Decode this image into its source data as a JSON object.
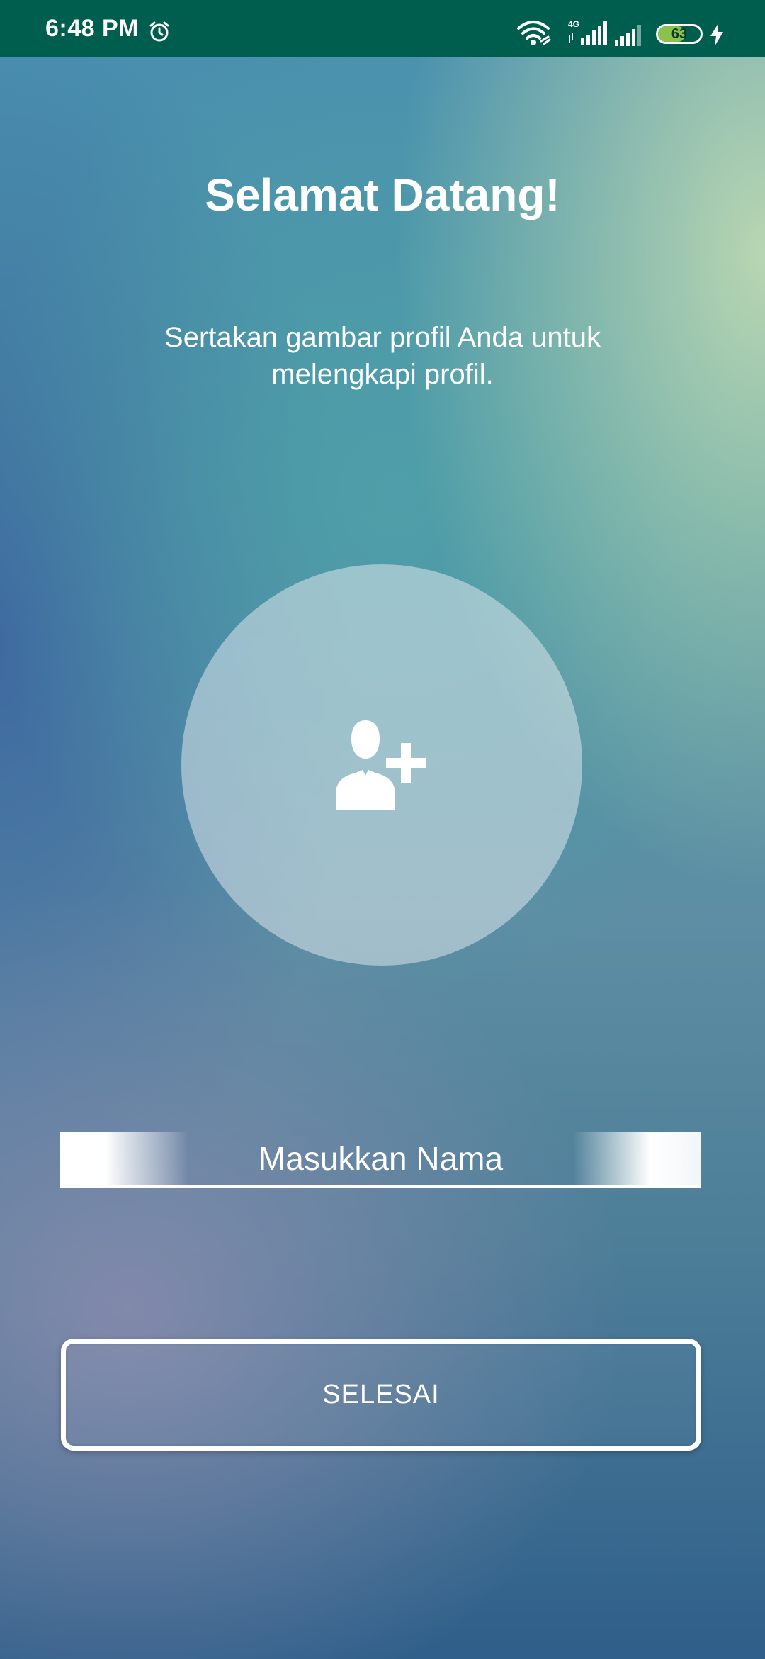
{
  "status_bar": {
    "time": "6:48 PM",
    "network_type": "4G",
    "battery_level": "63",
    "icons": [
      "alarm-icon",
      "wifi-icon",
      "signal-icon",
      "signal-icon",
      "battery-icon",
      "charging-icon"
    ]
  },
  "main": {
    "title": "Selamat Datang!",
    "subtitle": "Sertakan gambar profil Anda untuk melengkapi profil.",
    "avatar_picker_icon": "add-user-icon",
    "name_input": {
      "placeholder": "Masukkan Nama",
      "value": ""
    },
    "done_button_label": "SELESAI"
  },
  "colors": {
    "status_bar_bg": "#005e4f",
    "battery_fill": "#8bc34a",
    "text": "#ffffff"
  }
}
